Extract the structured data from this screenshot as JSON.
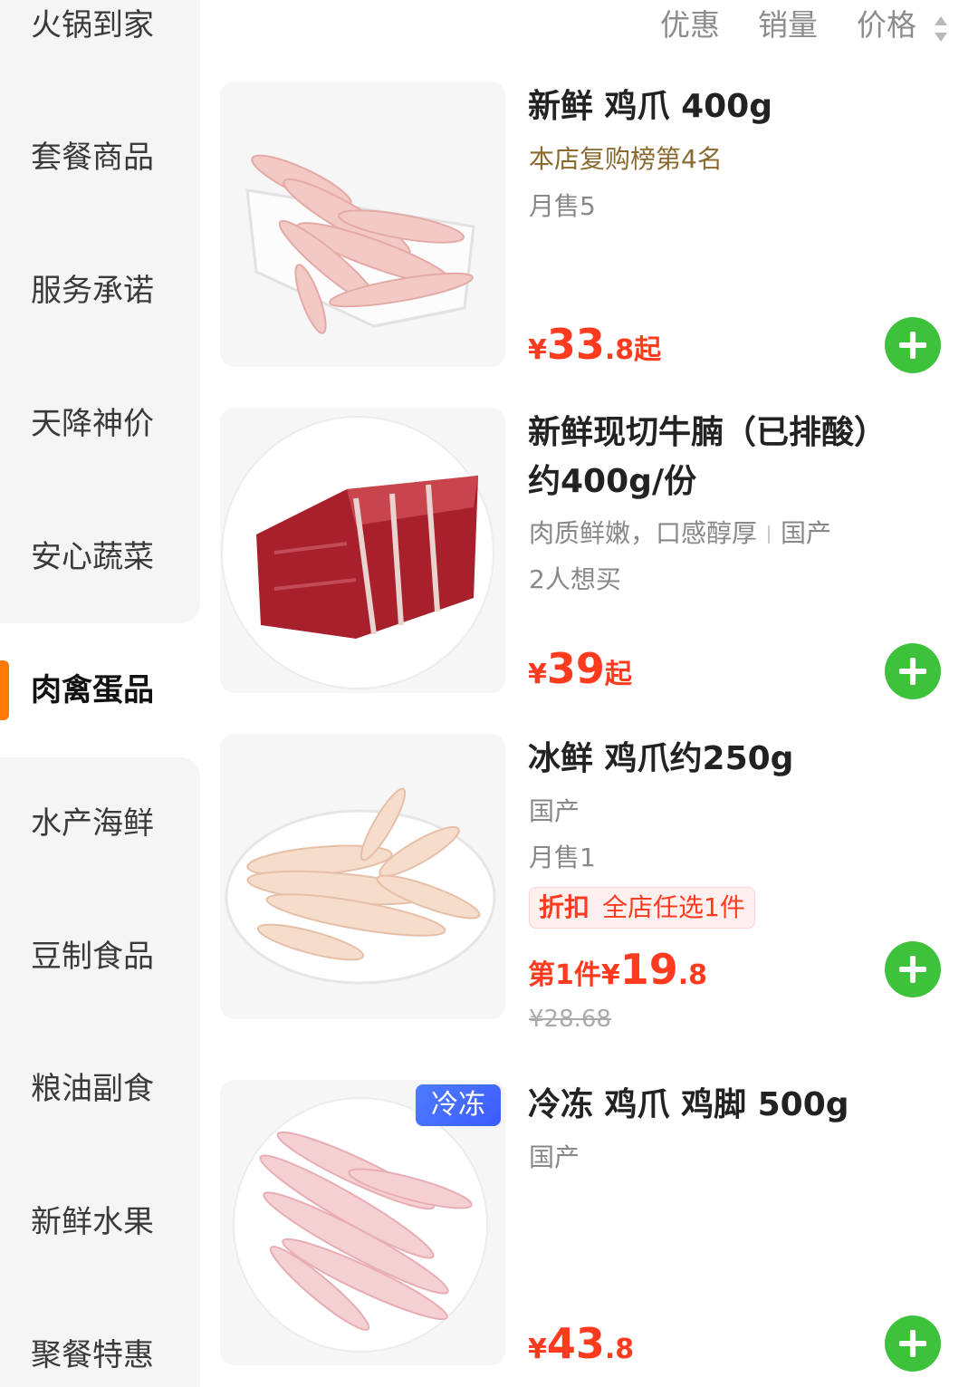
{
  "sidebar": {
    "items": [
      {
        "label": "火锅到家"
      },
      {
        "label": "套餐商品"
      },
      {
        "label": "服务承诺"
      },
      {
        "label": "天降神价"
      },
      {
        "label": "安心蔬菜"
      },
      {
        "label": "肉禽蛋品",
        "active": true
      },
      {
        "label": "水产海鲜"
      },
      {
        "label": "豆制食品"
      },
      {
        "label": "粮油副食"
      },
      {
        "label": "新鲜水果"
      },
      {
        "label": "聚餐特惠"
      }
    ]
  },
  "sort": {
    "discount": "优惠",
    "sales": "销量",
    "price": "价格"
  },
  "products": [
    {
      "title": "新鲜 鸡爪 400g",
      "rank": "本店复购榜第4名",
      "sales": "月售5",
      "price_symbol": "¥",
      "price_int": "33",
      "price_dec": ".8",
      "price_suffix": "起"
    },
    {
      "title_line1": "新鲜现切牛腩（已排酸）",
      "title_line2": "约400g/份",
      "desc": "肉质鲜嫩，口感醇厚",
      "origin": "国产",
      "wants": "2人想买",
      "price_symbol": "¥",
      "price_int": "39",
      "price_suffix": "起"
    },
    {
      "title": "冰鲜 鸡爪约250g",
      "origin": "国产",
      "sales": "月售1",
      "promo_tag": "折扣",
      "promo_desc": "全店任选1件",
      "price_prefix": "第1件",
      "price_symbol": "¥",
      "price_int": "19",
      "price_dec": ".8",
      "original_price": "¥28.68"
    },
    {
      "badge": "冷冻",
      "title": "冷冻 鸡爪 鸡脚 500g",
      "origin": "国产",
      "price_symbol": "¥",
      "price_int": "43",
      "price_dec": ".8"
    }
  ],
  "colors": {
    "accent": "#ff7a00",
    "price": "#ff3b1f",
    "add_button": "#3ec23c",
    "badge": "#3b5bff"
  }
}
